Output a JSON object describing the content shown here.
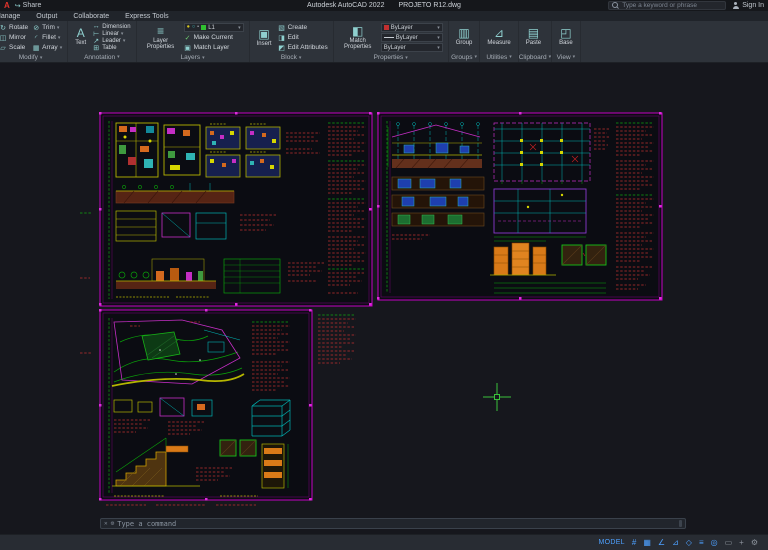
{
  "titlebar": {
    "logo": "A",
    "share_label": "Share",
    "app_title": "Autodesk AutoCAD 2022",
    "doc_title": "PROJETO R12.dwg",
    "search_placeholder": "Type a keyword or phrase",
    "sign_in": "Sign In"
  },
  "tabs": {
    "items": [
      "Manage",
      "Output",
      "Collaborate",
      "Express Tools"
    ]
  },
  "ribbon": {
    "modify": {
      "label": "Modify",
      "rotate": "Rotate",
      "mirror": "Mirror",
      "scale": "Scale",
      "trim": "Trim",
      "fillet": "Fillet",
      "array": "Array"
    },
    "annotation": {
      "label": "Annotation",
      "text": "Text",
      "dimension": "Dimension",
      "linear": "Linear",
      "leader": "Leader",
      "table": "Table"
    },
    "layers": {
      "label": "Layers",
      "layer_properties": "Layer Properties",
      "layer_name": "L1",
      "make_current": "Make Current",
      "match_layer": "Match Layer"
    },
    "block": {
      "label": "Block",
      "insert": "Insert",
      "create": "Create",
      "edit": "Edit",
      "edit_attributes": "Edit Attributes"
    },
    "properties": {
      "label": "Properties",
      "match_properties": "Match Properties",
      "values": [
        "ByLayer",
        "ByLayer",
        "ByLayer"
      ]
    },
    "groups": {
      "label": "Groups",
      "group": "Group"
    },
    "utilities": {
      "label": "Utilities",
      "measure": "Measure"
    },
    "clipboard": {
      "label": "Clipboard",
      "paste": "Paste"
    },
    "view": {
      "label": "View",
      "base": "Base"
    }
  },
  "commandline": {
    "placeholder": "Type a command"
  },
  "statusbar": {
    "model": "MODEL",
    "icons": [
      "#",
      "▦",
      "∠",
      "⊿",
      "◇",
      "≡",
      "◎",
      "▭",
      "+",
      "⚙"
    ]
  },
  "icons": {
    "caret": "▾",
    "rotate": "↻",
    "mirror": "◫",
    "scale": "▱",
    "trim": "⊘",
    "fillet": "◜",
    "array": "▦",
    "text": "A",
    "dimension": "↔",
    "linear": "⊢",
    "leader": "↗",
    "table": "⊞",
    "layer_properties": "≡",
    "bulb": "●",
    "freeze": "○",
    "lock": "▪",
    "make_current": "✓",
    "match_layer": "▣",
    "insert": "▣",
    "create": "▧",
    "edit": "◨",
    "edit_attributes": "◩",
    "match_properties": "◧",
    "group": "▥",
    "measure": "⊿",
    "paste": "▤",
    "base": "◰",
    "share": "↪",
    "close": "✕",
    "wrench": "⚙"
  },
  "colors": {
    "accent_blue": "#4da0ff",
    "sheet_border": "#c400c4",
    "crosshair": "#3fd43f"
  }
}
